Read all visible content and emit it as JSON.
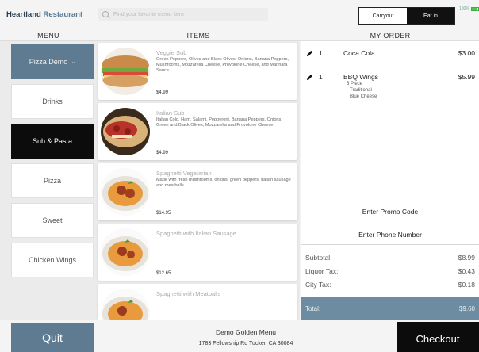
{
  "header": {
    "brand_part1": "Heartland",
    "brand_part2": "Restaurant",
    "search_placeholder": "Find your favorite menu item",
    "order_type_options": [
      "Carryout",
      "Eat in"
    ],
    "selected_order_type": "Eat in",
    "battery_percent": "100%"
  },
  "columns": {
    "menu": "MENU",
    "items": "ITEMS",
    "order": "MY ORDER"
  },
  "menu": {
    "categories": [
      {
        "label": "Pizza Demo",
        "state": "selected",
        "has_dropdown": true
      },
      {
        "label": "Drinks",
        "state": "normal"
      },
      {
        "label": "Sub & Pasta",
        "state": "highlighted"
      },
      {
        "label": "Pizza",
        "state": "normal"
      },
      {
        "label": "Sweet",
        "state": "normal"
      },
      {
        "label": "Chicken Wings",
        "state": "normal"
      }
    ]
  },
  "items": [
    {
      "title": "Veggie Sub",
      "description": "Green Peppers, Olives and Black Olives, Onions, Banana Peppers, Mushrooms, Mozzarella Cheese, Provolone Cheese, and Marinara Sauce",
      "price": "$4.99",
      "image": "sub-sandwich"
    },
    {
      "title": "Italian Sub",
      "description": "Italian Cold, Ham, Salami, Pepperoni, Banana Peppers, Onions, Green and Black Olives, Mozzarella and Provolone Cheese",
      "price": "$4.99",
      "image": "italian-sub"
    },
    {
      "title": "Spaghetti Vegetarian",
      "description": "Made with fresh mushrooms, onions, green peppers, Italian sausage and meatballs",
      "price": "$14.95",
      "image": "spaghetti"
    },
    {
      "title": "Spaghetti with Italian Sausage",
      "description": "",
      "price": "$12.65",
      "image": "spaghetti"
    },
    {
      "title": "Spaghetti with Meatballs",
      "description": "",
      "price": "",
      "image": "spaghetti"
    }
  ],
  "order": {
    "lines": [
      {
        "qty": "1",
        "name": "Coca Cola",
        "amount": "$3.00",
        "modifiers": []
      },
      {
        "qty": "1",
        "name": "BBQ Wings",
        "amount": "$5.99",
        "modifiers": [
          "6 Piece",
          "Traditional",
          "Blue Cheese"
        ]
      }
    ],
    "promo_label": "Enter Promo Code",
    "phone_label": "Enter Phone Number",
    "subtotal_label": "Subtotal:",
    "subtotal": "$8.99",
    "liquor_label": "Liquor Tax:",
    "liquor": "$0.43",
    "city_label": "City Tax:",
    "city": "$0.18",
    "total_label": "Total:",
    "total": "$9.60"
  },
  "footer": {
    "quit_label": "Quit",
    "store_name": "Demo Golden Menu",
    "store_address": "1783 Fellowship Rd Tucker, CA 30084",
    "checkout_label": "Checkout"
  },
  "colors": {
    "accent": "#5e7b92",
    "dark": "#0c0c0c",
    "total_bar": "#6d8ba1"
  }
}
